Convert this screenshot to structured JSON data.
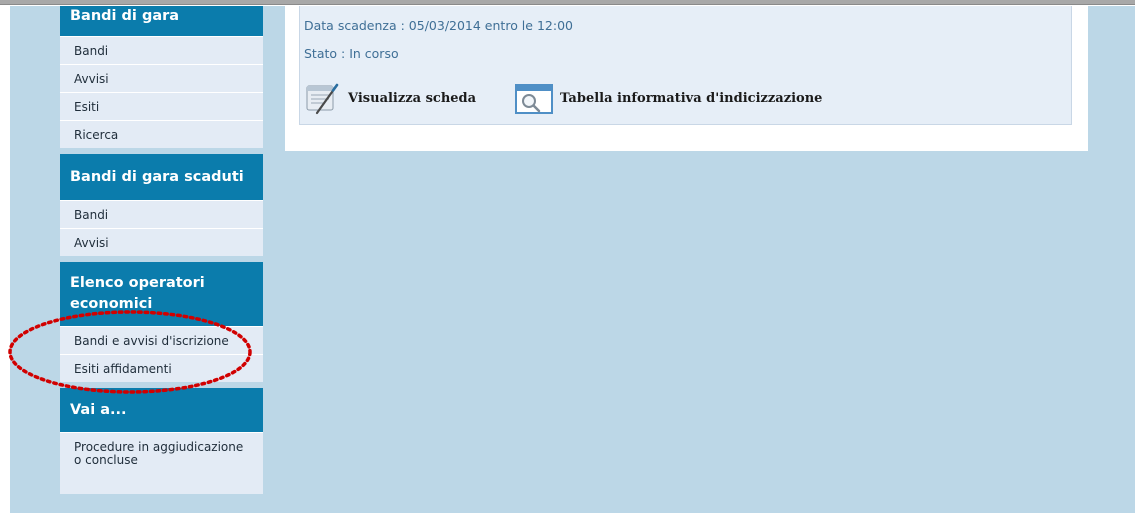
{
  "sidebar": {
    "sections": [
      {
        "title": "Bandi di gara",
        "items": [
          "Bandi",
          "Avvisi",
          "Esiti",
          "Ricerca"
        ]
      },
      {
        "title": "Bandi di gara scaduti",
        "items": [
          "Bandi",
          "Avvisi"
        ]
      },
      {
        "title": "Elenco operatori economici",
        "items": [
          "Bandi e avvisi d'iscrizione",
          "Esiti affidamenti"
        ]
      },
      {
        "title": "Vai a...",
        "items": [
          "Procedure in aggiudicazione o concluse"
        ]
      }
    ]
  },
  "detail": {
    "deadline": "Data scadenza : 05/03/2014 entro le 12:00",
    "status": "Stato : In corso",
    "actions": {
      "view": "Visualizza scheda",
      "table": "Tabella informativa d'indicizzazione"
    }
  },
  "colors": {
    "page_background": "#bcd7e7",
    "section_header": "#0b7cac",
    "menu_item": "#e3ebf5",
    "detail_text": "#3f6f96",
    "annotation": "#d10000"
  },
  "icons": {
    "view": "notepad-pencil-icon",
    "table": "magnifier-window-icon"
  }
}
